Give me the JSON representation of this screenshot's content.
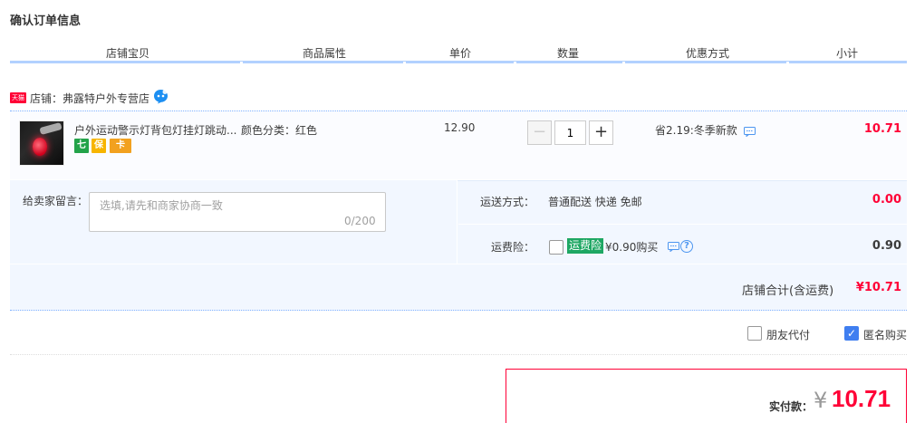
{
  "page": {
    "title": "确认订单信息"
  },
  "columns": [
    "店铺宝贝",
    "商品属性",
    "单价",
    "数量",
    "优惠方式",
    "小计"
  ],
  "shop": {
    "badge": "天猫",
    "name": "店铺：弗露特户外专营店"
  },
  "item": {
    "title": "户外运动警示灯背包灯挂灯跳动...",
    "service_icons": [
      "七",
      "保",
      "卡"
    ],
    "sku": "颜色分类：红色",
    "price": "12.90",
    "quantity": "1",
    "qty_minus": "−",
    "qty_plus": "+",
    "promo": "省2.19:冬季新款",
    "subtotal": "10.71"
  },
  "message": {
    "label": "给卖家留言：",
    "placeholder": "选填,请先和商家协商一致",
    "counter": "0/200"
  },
  "shipping": {
    "label": "运送方式：",
    "value": "普通配送 快递 免邮",
    "fee": "0.00"
  },
  "insurance": {
    "label": "运费险：",
    "badge": "运费险",
    "price": "¥0.90购买",
    "help": "?",
    "fee": "0.90"
  },
  "shop_total": {
    "label": "店铺合计(含运费)",
    "value": "¥10.71"
  },
  "options": {
    "friend_pay": {
      "label": "朋友代付",
      "checked": false
    },
    "anonymous": {
      "label": "匿名购买",
      "checked": true,
      "mark": "✓"
    }
  },
  "payment": {
    "label": "实付款：",
    "currency": "¥",
    "amount": "10.71"
  },
  "colors": {
    "accent": "#ff0036",
    "link_blue": "#3f7ef0",
    "header_line": "#b2d1ff",
    "panel_bg": "#f2f7ff",
    "insurance_green": "#1ea763"
  }
}
